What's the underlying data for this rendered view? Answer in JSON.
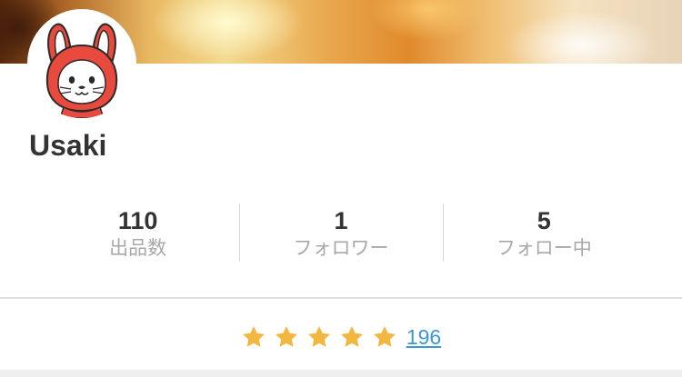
{
  "profile": {
    "username": "Usaki",
    "avatar_icon": "rabbit-avatar-icon"
  },
  "stats": [
    {
      "value": "110",
      "label": "出品数"
    },
    {
      "value": "1",
      "label": "フォロワー"
    },
    {
      "value": "5",
      "label": "フォロー中"
    }
  ],
  "rating": {
    "stars": 5,
    "max_stars": 5,
    "review_count": "196",
    "star_color": "#f3b63f",
    "link_color": "#3d96d6"
  }
}
